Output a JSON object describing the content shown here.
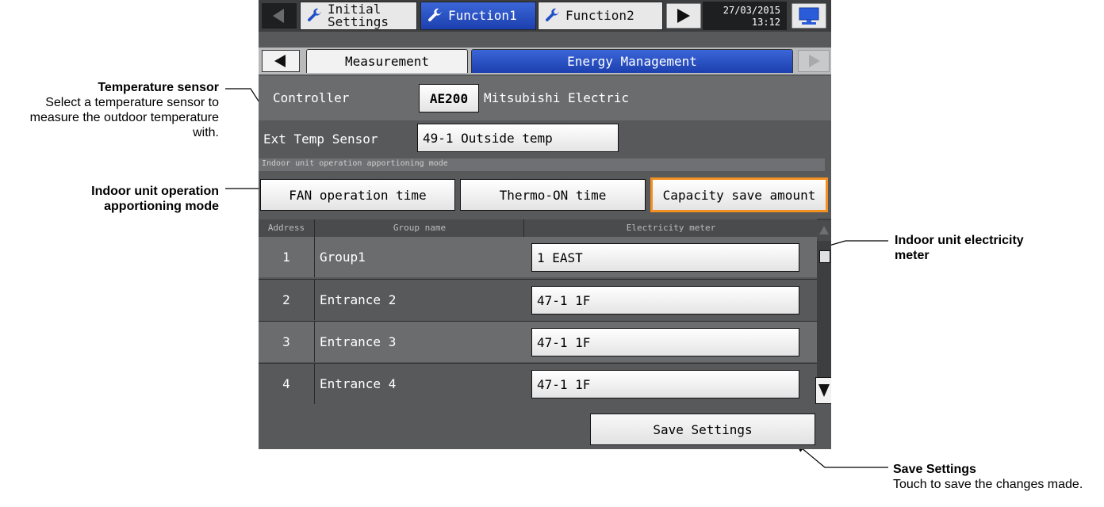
{
  "annotations": {
    "temp_sensor_title": "Temperature sensor",
    "temp_sensor_desc": "Select a temperature sensor to measure the outdoor temperature with.",
    "apportion_title": "Indoor unit operation apportioning mode",
    "meter_title": "Indoor unit electricity meter",
    "save_title": "Save Settings",
    "save_desc": "Touch to save the changes made."
  },
  "topbar": {
    "tabs": [
      {
        "label": "Initial\nSettings"
      },
      {
        "label": "Function1"
      },
      {
        "label": "Function2"
      }
    ],
    "datetime": "27/03/2015\n13:12"
  },
  "subtabs": {
    "measurement": "Measurement",
    "energy": "Energy Management"
  },
  "controller": {
    "label": "Controller",
    "model": "AE200",
    "maker": "Mitsubishi Electric"
  },
  "ext_temp": {
    "label": "Ext Temp Sensor",
    "value": "49-1 Outside temp"
  },
  "apportion": {
    "section_label": "Indoor unit operation apportioning mode",
    "options": [
      "FAN operation time",
      "Thermo-ON time",
      "Capacity save amount"
    ],
    "selected": "Capacity save amount"
  },
  "table": {
    "headers": [
      "Address",
      "Group name",
      "Electricity meter"
    ],
    "rows": [
      {
        "address": "1",
        "group": "Group1",
        "meter": "1 EAST"
      },
      {
        "address": "2",
        "group": "Entrance 2",
        "meter": "47-1 1F"
      },
      {
        "address": "3",
        "group": "Entrance 3",
        "meter": "47-1 1F"
      },
      {
        "address": "4",
        "group": "Entrance 4",
        "meter": "47-1 1F"
      }
    ]
  },
  "save_button": "Save Settings",
  "colors": {
    "accent_blue": "#1c3fae",
    "selected_orange": "#f29022",
    "panel_grey": "#58595b"
  }
}
